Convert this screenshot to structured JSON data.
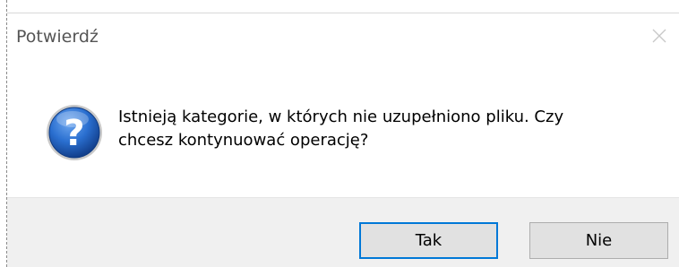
{
  "window": {
    "title": "Potwierdź"
  },
  "message": {
    "line1": "Istnieją kategorie, w których nie uzupełniono pliku. Czy",
    "line2": "chcesz kontynuować operację?"
  },
  "icon": {
    "type": "question-icon",
    "symbol": "?"
  },
  "buttons": {
    "yes_label": "Tak",
    "no_label": "Nie"
  },
  "colors": {
    "focus_border": "#0078d7",
    "button_bar_bg": "#f0f0f0",
    "icon_blue": "#1e5fb4"
  }
}
